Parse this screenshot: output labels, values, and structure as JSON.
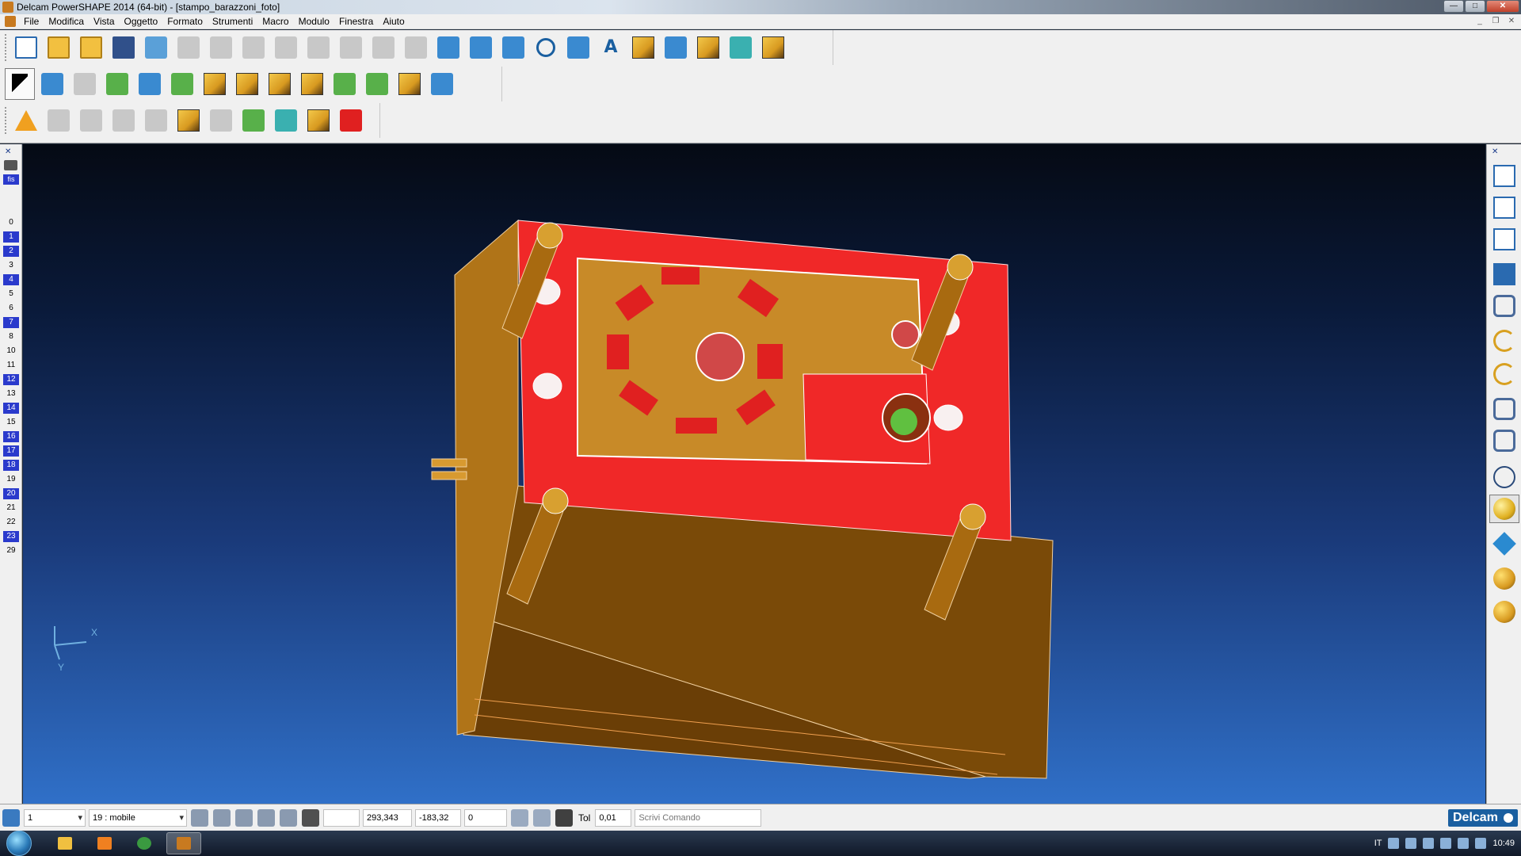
{
  "window": {
    "title": "Delcam PowerSHAPE 2014 (64-bit) - [stampo_barazzoni_foto]",
    "buttons": [
      "minimize",
      "maximize",
      "close"
    ]
  },
  "menubar": {
    "items": [
      "File",
      "Modifica",
      "Vista",
      "Oggetto",
      "Formato",
      "Strumenti",
      "Macro",
      "Modulo",
      "Finestra",
      "Aiuto"
    ]
  },
  "toolbars": {
    "row1": [
      "new-icon",
      "open-icon",
      "import-icon",
      "save-icon",
      "print-icon",
      "cut-icon",
      "copy-icon",
      "paste-icon",
      "edit-icon",
      "delete-icon",
      "undo-icon",
      "redo-icon",
      "draw-icon",
      "wireframe-icon",
      "workplane-icon",
      "line-icon",
      "circle-icon",
      "curve-icon",
      "text-icon",
      "surface-icon",
      "solid-icon",
      "feature-icon",
      "settings-icon",
      "magic-icon"
    ],
    "row2": [
      "select-icon",
      "pan-icon",
      "layer-icon",
      "dimension-icon",
      "box-icon",
      "rotate-icon",
      "solid1-icon",
      "solid2-icon",
      "solid3-icon",
      "solid4-icon",
      "wave-icon",
      "grid-icon",
      "sphere-icon",
      "pyramid-icon"
    ],
    "row3": [
      "warning-icon",
      "tool1-icon",
      "tool2-icon",
      "tool3-icon",
      "tool4-icon",
      "tool5-icon",
      "tool6-icon",
      "tool7-icon",
      "tool8-icon",
      "tool9-icon",
      "medical-icon"
    ]
  },
  "layers": {
    "fis_label": "fis",
    "items": [
      {
        "num": "0",
        "on": false
      },
      {
        "num": "1",
        "on": true
      },
      {
        "num": "2",
        "on": true
      },
      {
        "num": "3",
        "on": false
      },
      {
        "num": "4",
        "on": true
      },
      {
        "num": "5",
        "on": false
      },
      {
        "num": "6",
        "on": false
      },
      {
        "num": "7",
        "on": true
      },
      {
        "num": "8",
        "on": false
      },
      {
        "num": "10",
        "on": false
      },
      {
        "num": "11",
        "on": false
      },
      {
        "num": "12",
        "on": true
      },
      {
        "num": "13",
        "on": false
      },
      {
        "num": "14",
        "on": true
      },
      {
        "num": "15",
        "on": false
      },
      {
        "num": "16",
        "on": true
      },
      {
        "num": "17",
        "on": true
      },
      {
        "num": "18",
        "on": true
      },
      {
        "num": "19",
        "on": false
      },
      {
        "num": "20",
        "on": true
      },
      {
        "num": "21",
        "on": false
      },
      {
        "num": "22",
        "on": false
      },
      {
        "num": "23",
        "on": true
      },
      {
        "num": "29",
        "on": false
      }
    ]
  },
  "viewport": {
    "axis_x": "X",
    "axis_y": "Y",
    "colors": {
      "mold_red": "#f02828",
      "mold_gold": "#c88a28",
      "mold_brown": "#7a4a08"
    }
  },
  "statusbar": {
    "workplane_value": "1",
    "level_value": "19 : mobile",
    "coord_x": "293,343",
    "coord_y": "-183,32",
    "coord_z": "0",
    "tol_label": "Tol",
    "tol_value": "0,01",
    "command_placeholder": "Scrivi Comando",
    "brand": "Delcam"
  },
  "taskbar": {
    "language": "IT",
    "time": "10:49"
  }
}
